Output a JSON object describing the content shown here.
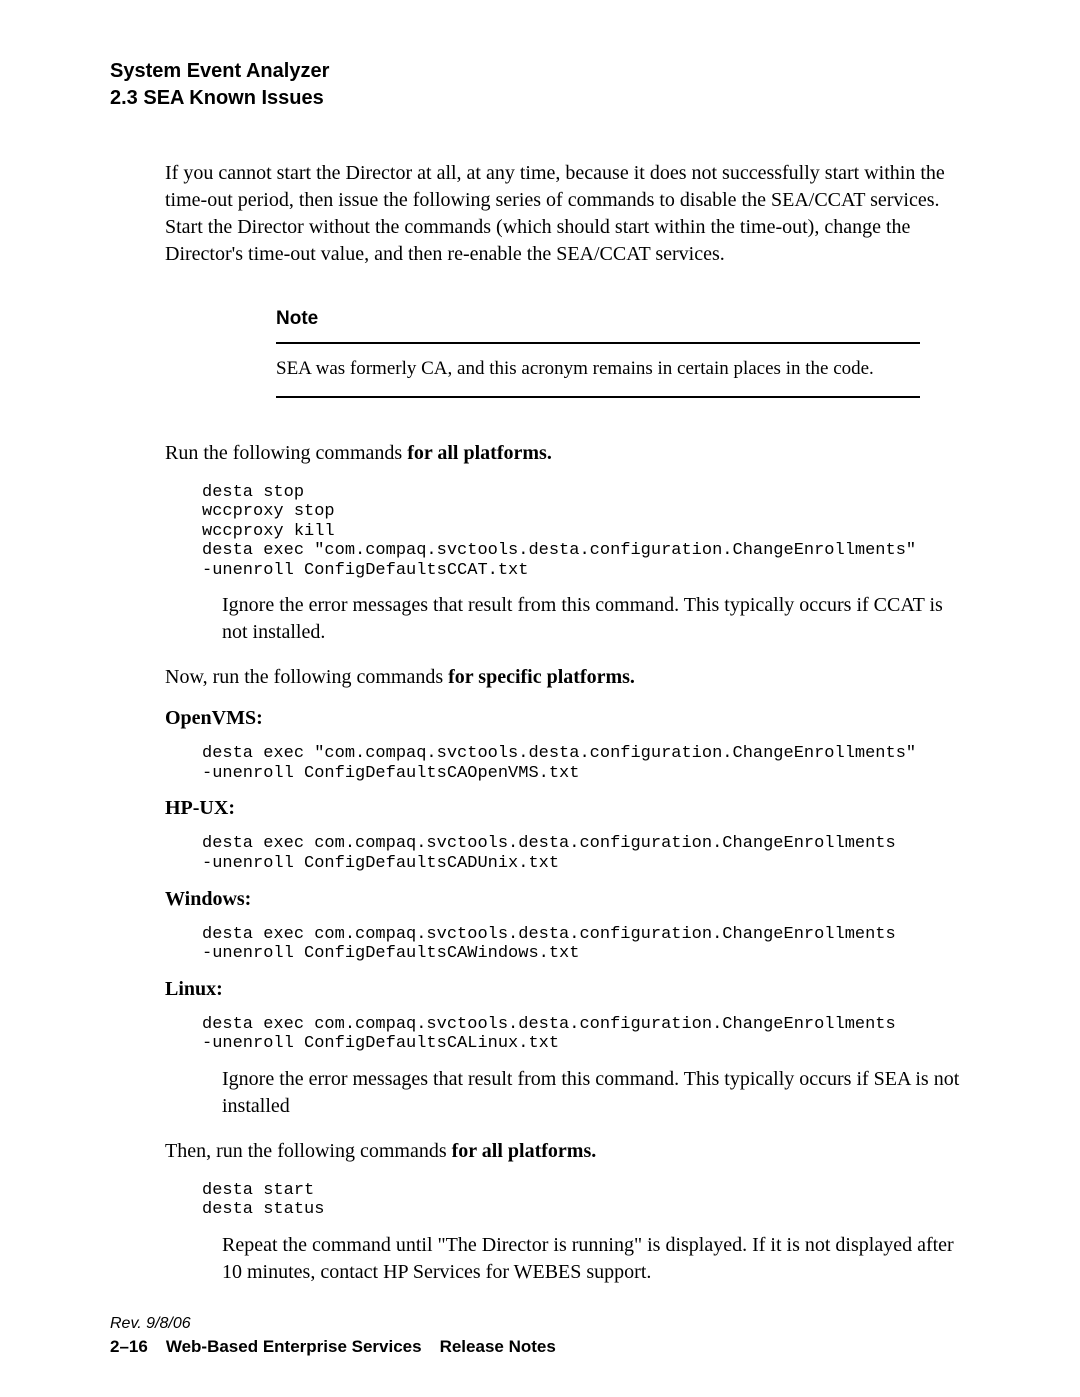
{
  "header": {
    "title1": "System Event Analyzer",
    "title2": "2.3  SEA Known Issues"
  },
  "intro": "If you cannot start the Director at all, at any time, because it does not successfully start within the time-out period, then issue the following series of commands to disable the SEA/CCAT services. Start the Director without the commands (which should start within the time-out), change the Director's time-out value, and then re-enable the SEA/CCAT services.",
  "note": {
    "label": "Note",
    "text": "SEA was formerly CA, and this acronym remains in certain places in the code."
  },
  "run1_prefix": "Run the following commands ",
  "run1_bold": "for all platforms.",
  "code1": "desta stop\nwccproxy stop\nwccproxy kill\ndesta exec \"com.compaq.svctools.desta.configuration.ChangeEnrollments\"\n-unenroll ConfigDefaultsCCAT.txt",
  "ignore1": "Ignore the error messages that result from this command. This typically occurs if CCAT is not installed.",
  "run2_prefix": "Now, run the following commands ",
  "run2_bold": "for specific platforms.",
  "platforms": {
    "openvms": {
      "label": "OpenVMS:",
      "code": "desta exec \"com.compaq.svctools.desta.configuration.ChangeEnrollments\"\n-unenroll ConfigDefaultsCAOpenVMS.txt"
    },
    "hpux": {
      "label": "HP-UX:",
      "code": "desta exec com.compaq.svctools.desta.configuration.ChangeEnrollments\n-unenroll ConfigDefaultsCADUnix.txt"
    },
    "windows": {
      "label": "Windows:",
      "code": "desta exec com.compaq.svctools.desta.configuration.ChangeEnrollments\n-unenroll ConfigDefaultsCAWindows.txt"
    },
    "linux": {
      "label": "Linux:",
      "code": "desta exec com.compaq.svctools.desta.configuration.ChangeEnrollments\n-unenroll ConfigDefaultsCALinux.txt"
    }
  },
  "ignore2": "Ignore the error messages that result from this command. This typically occurs if SEA is not installed",
  "run3_prefix": "Then, run the following commands ",
  "run3_bold": "for all platforms.",
  "code3": "desta start\ndesta status",
  "repeat": "Repeat the command until \"The Director is running\" is displayed. If it is not displayed after 10 minutes, contact HP Services for WEBES support.",
  "footer": {
    "rev": "Rev. 9/8/06",
    "page": "2–16",
    "doc": "Web-Based Enterprise Services",
    "section": "Release Notes"
  }
}
